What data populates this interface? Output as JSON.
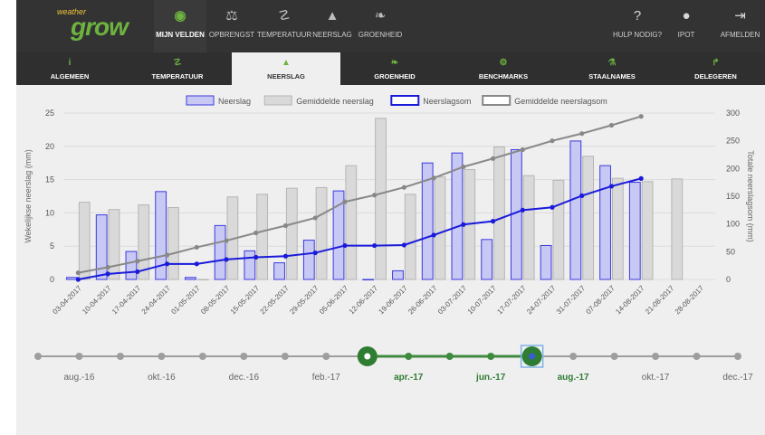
{
  "app": {
    "logo_small": "weather",
    "logo_big": "grow"
  },
  "nav": [
    {
      "label": "MIJN VELDEN",
      "icon": "map-pin-icon",
      "active": true
    },
    {
      "label": "OPBRENGST",
      "icon": "scale-icon",
      "active": false
    },
    {
      "label": "TEMPERATUUR",
      "icon": "thermometer-icon",
      "active": false
    },
    {
      "label": "NEERSLAG",
      "icon": "droplet-icon",
      "active": false
    },
    {
      "label": "GROENHEID",
      "icon": "leaf-icon",
      "active": false
    }
  ],
  "nav_right": [
    {
      "label": "HULP NODIG?",
      "icon": "help-icon"
    },
    {
      "label": "IPOT",
      "icon": "user-icon"
    },
    {
      "label": "AFMELDEN",
      "icon": "logout-icon"
    }
  ],
  "tabs": [
    {
      "label": "ALGEMEEN",
      "icon": "info-icon",
      "active": false
    },
    {
      "label": "TEMPERATUUR",
      "icon": "thermometer-icon",
      "active": false
    },
    {
      "label": "NEERSLAG",
      "icon": "droplet-icon",
      "active": true
    },
    {
      "label": "GROENHEID",
      "icon": "leaf-icon",
      "active": false
    },
    {
      "label": "BENCHMARKS",
      "icon": "gear-icon",
      "active": false
    },
    {
      "label": "STAALNAMES",
      "icon": "flask-icon",
      "active": false
    },
    {
      "label": "DELEGEREN",
      "icon": "share-icon",
      "active": false
    }
  ],
  "chart_data": {
    "type": "bar",
    "categories": [
      "03-04-2017",
      "10-04-2017",
      "17-04-2017",
      "24-04-2017",
      "01-05-2017",
      "08-05-2017",
      "15-05-2017",
      "22-05-2017",
      "29-05-2017",
      "05-06-2017",
      "12-06-2017",
      "19-06-2017",
      "26-06-2017",
      "03-07-2017",
      "10-07-2017",
      "17-07-2017",
      "24-07-2017",
      "31-07-2017",
      "07-08-2017",
      "14-08-2017",
      "21-08-2017",
      "28-08-2017"
    ],
    "series": [
      {
        "name": "Neerslag",
        "kind": "bar",
        "axis": "left",
        "color": "#3b3bdc",
        "values": [
          0.3,
          9.7,
          4.2,
          13.2,
          0.3,
          8.1,
          4.3,
          2.5,
          5.9,
          13.3,
          0,
          1.3,
          17.5,
          19.0,
          6.0,
          19.5,
          5.1,
          20.8,
          17.1,
          14.6,
          null,
          null
        ]
      },
      {
        "name": "Gemiddelde neerslag",
        "kind": "bar",
        "axis": "left",
        "color": "#bdbdbd",
        "values": [
          11.6,
          10.5,
          11.2,
          10.8,
          0,
          12.4,
          12.8,
          13.7,
          13.8,
          17.1,
          24.2,
          12.8,
          15.4,
          16.5,
          19.9,
          15.6,
          14.9,
          18.5,
          15.2,
          14.7,
          15.1,
          null
        ]
      },
      {
        "name": "Neerslagsom",
        "kind": "line",
        "axis": "right",
        "color": "#1a1adb",
        "values": [
          0,
          10,
          14,
          28,
          28,
          36,
          40,
          42,
          48,
          61,
          61,
          62,
          80,
          99,
          105,
          125,
          130,
          151,
          168,
          182,
          null,
          null
        ]
      },
      {
        "name": "Gemiddelde neerslagsom",
        "kind": "line",
        "axis": "right",
        "color": "#8a8a8a",
        "values": [
          12,
          22,
          33,
          44,
          58,
          70,
          84,
          97,
          111,
          140,
          152,
          166,
          183,
          203,
          218,
          234,
          250,
          263,
          278,
          294,
          null,
          null
        ]
      }
    ],
    "ylabel": "Wekelijkse neerslag (mm)",
    "ylabel_right": "Totale neerslagsom (mm)",
    "ylim": [
      0,
      25
    ],
    "yticks": [
      0,
      5,
      10,
      15,
      20,
      25
    ],
    "ylim_right": [
      0,
      300
    ],
    "yticks_right": [
      0,
      50,
      100,
      150,
      200,
      250,
      300
    ],
    "grid": true,
    "legend_position": "top-center"
  },
  "timeline": {
    "labels": [
      "aug.-16",
      "okt.-16",
      "dec.-16",
      "feb.-17",
      "apr.-17",
      "jun.-17",
      "aug.-17",
      "okt.-17",
      "dec.-17"
    ],
    "range_start": "apr.-17",
    "range_end": "aug.-17"
  }
}
